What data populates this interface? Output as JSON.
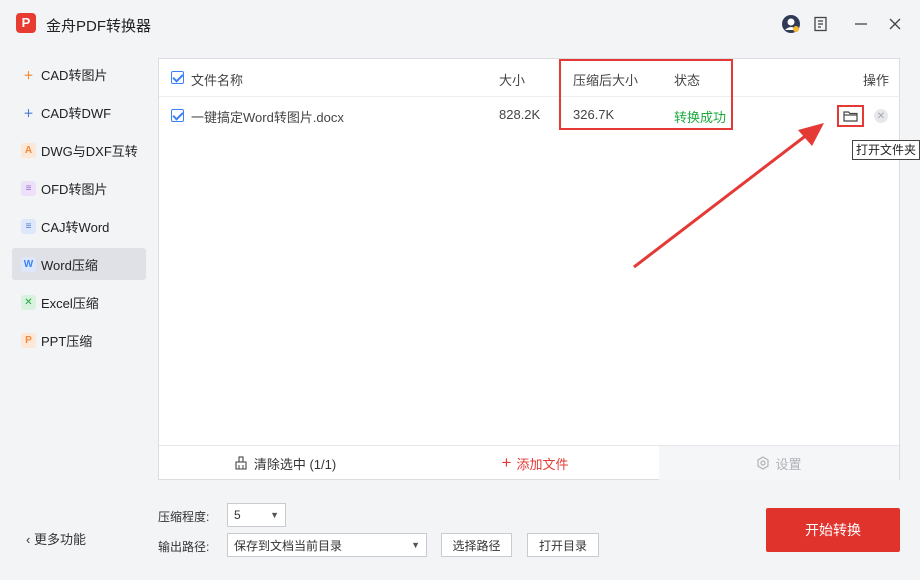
{
  "app": {
    "logo_letter": "P",
    "title": "金舟PDF转换器"
  },
  "sidebar": {
    "items": [
      {
        "label": "CAD转图片",
        "icon": "cad-plus-icon",
        "color": "#f08a3c",
        "active": false
      },
      {
        "label": "CAD转DWF",
        "icon": "cad-plus-icon",
        "color": "#4a7bd9",
        "active": false
      },
      {
        "label": "DWG与DXF互转",
        "icon": "dwg-compass-icon",
        "color": "#f08a3c",
        "active": false
      },
      {
        "label": "OFD转图片",
        "icon": "ofd-doc-icon",
        "color": "#9b6ad6",
        "active": false
      },
      {
        "label": "CAJ转Word",
        "icon": "caj-doc-icon",
        "color": "#4a7bd9",
        "active": false
      },
      {
        "label": "Word压缩",
        "icon": "word-compress-icon",
        "color": "#3b82f6",
        "active": true
      },
      {
        "label": "Excel压缩",
        "icon": "excel-compress-icon",
        "color": "#1aab3f",
        "active": false
      },
      {
        "label": "PPT压缩",
        "icon": "ppt-compress-icon",
        "color": "#f08a3c",
        "active": false
      }
    ],
    "more_label": "更多功能"
  },
  "table": {
    "headers": {
      "name": "文件名称",
      "size": "大小",
      "compressed": "压缩后大小",
      "status": "状态",
      "action": "操作"
    },
    "rows": [
      {
        "name": "一键搞定Word转图片.docx",
        "size": "828.2K",
        "compressed": "326.7K",
        "status": "转换成功",
        "checked": true
      }
    ]
  },
  "tooltip": "打开文件夹",
  "panel_footer": {
    "clear_label": "清除选中 (1/1)",
    "add_label": "添加文件",
    "settings_label": "设置"
  },
  "options": {
    "level_label": "压缩程度:",
    "level_value": "5",
    "output_label": "输出路径:",
    "output_value": "保存到文档当前目录",
    "choose_path_label": "选择路径",
    "open_dir_label": "打开目录"
  },
  "start_label": "开始转换",
  "colors": {
    "accent_red": "#e0332c",
    "success_green": "#1aab3f",
    "check_blue": "#3b82f6"
  }
}
